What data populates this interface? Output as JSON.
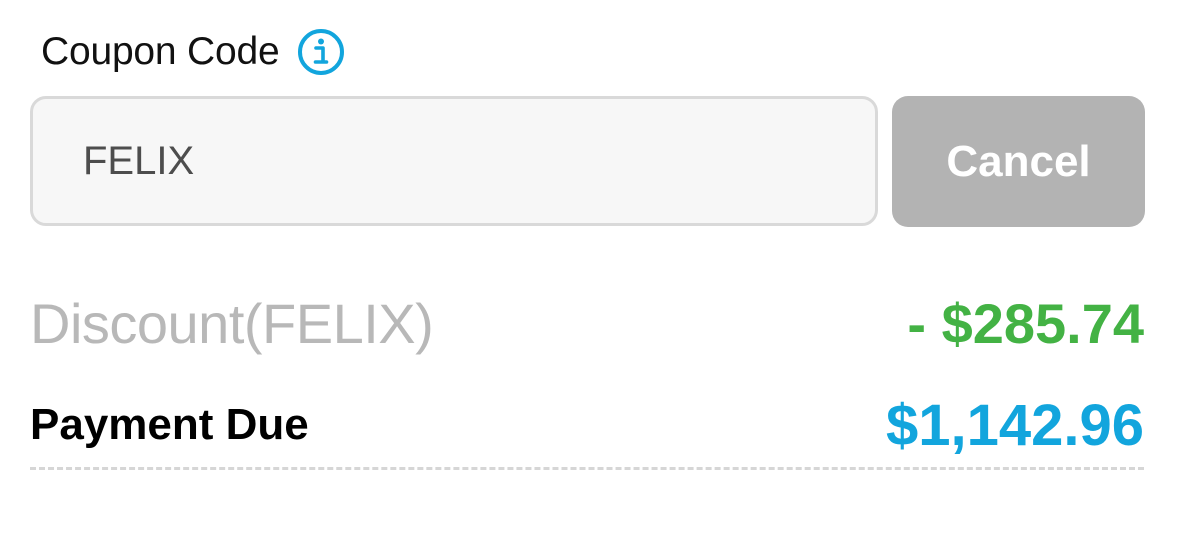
{
  "coupon": {
    "label": "Coupon Code",
    "info_icon": "info-circle-icon",
    "input_value": "FELIX",
    "cancel_label": "Cancel"
  },
  "summary": {
    "discount_label": "Discount(FELIX)",
    "discount_amount": "- $285.74",
    "payment_label": "Payment Due",
    "payment_amount": "$1,142.96"
  },
  "colors": {
    "accent_blue": "#12a5dd",
    "discount_green": "#43b244",
    "cancel_gray": "#b3b3b3",
    "muted_text": "#b8b8b8"
  }
}
